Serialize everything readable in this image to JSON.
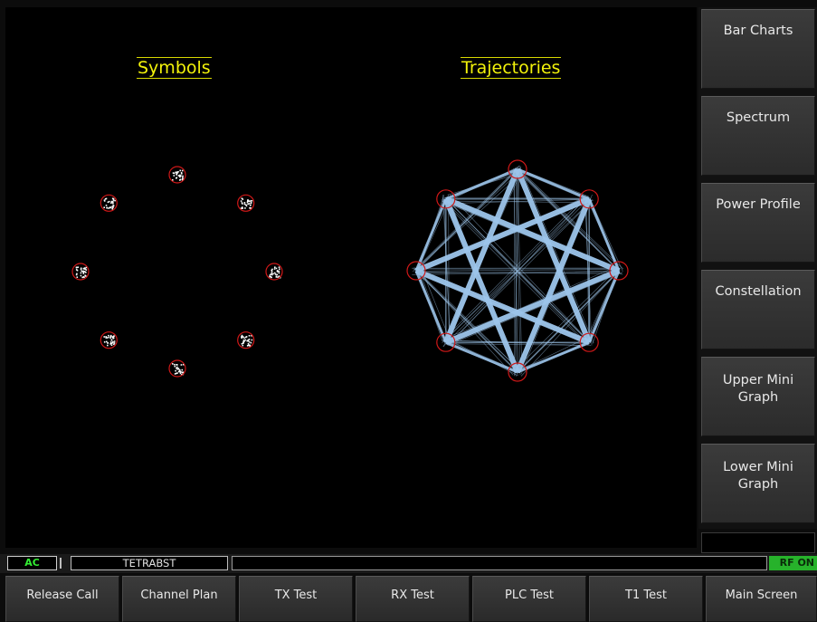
{
  "display": {
    "symbols_title": "Symbols",
    "trajectories_title": "Trajectories",
    "constellation_points": 8,
    "colors": {
      "background": "#000000",
      "title": "#f2f20a",
      "symbol_dots": "#ffffff",
      "marker_circles": "#d01818",
      "trajectory_lines": "#9cc4ea"
    }
  },
  "sidebar": {
    "buttons": [
      {
        "label_lines": [
          "Bar Charts"
        ]
      },
      {
        "label_lines": [
          "Spectrum"
        ]
      },
      {
        "label_lines": [
          "Power Profile"
        ]
      },
      {
        "label_lines": [
          "Constellation"
        ]
      },
      {
        "label_lines": [
          "Upper Mini",
          "Graph"
        ]
      },
      {
        "label_lines": [
          "Lower Mini",
          "Graph"
        ]
      }
    ]
  },
  "statusbar": {
    "ac_label": "AC",
    "mode_name": "TETRABST",
    "message": "",
    "rf_label": "RF ON",
    "colors": {
      "ac_text": "#33ee33",
      "rf_bg": "#27b22b"
    }
  },
  "bottombar": {
    "buttons": [
      {
        "label": "Release Call"
      },
      {
        "label": "Channel Plan"
      },
      {
        "label": "TX Test"
      },
      {
        "label": "RX Test"
      },
      {
        "label": "PLC Test"
      },
      {
        "label": "T1 Test"
      },
      {
        "label": "Main Screen"
      }
    ]
  }
}
